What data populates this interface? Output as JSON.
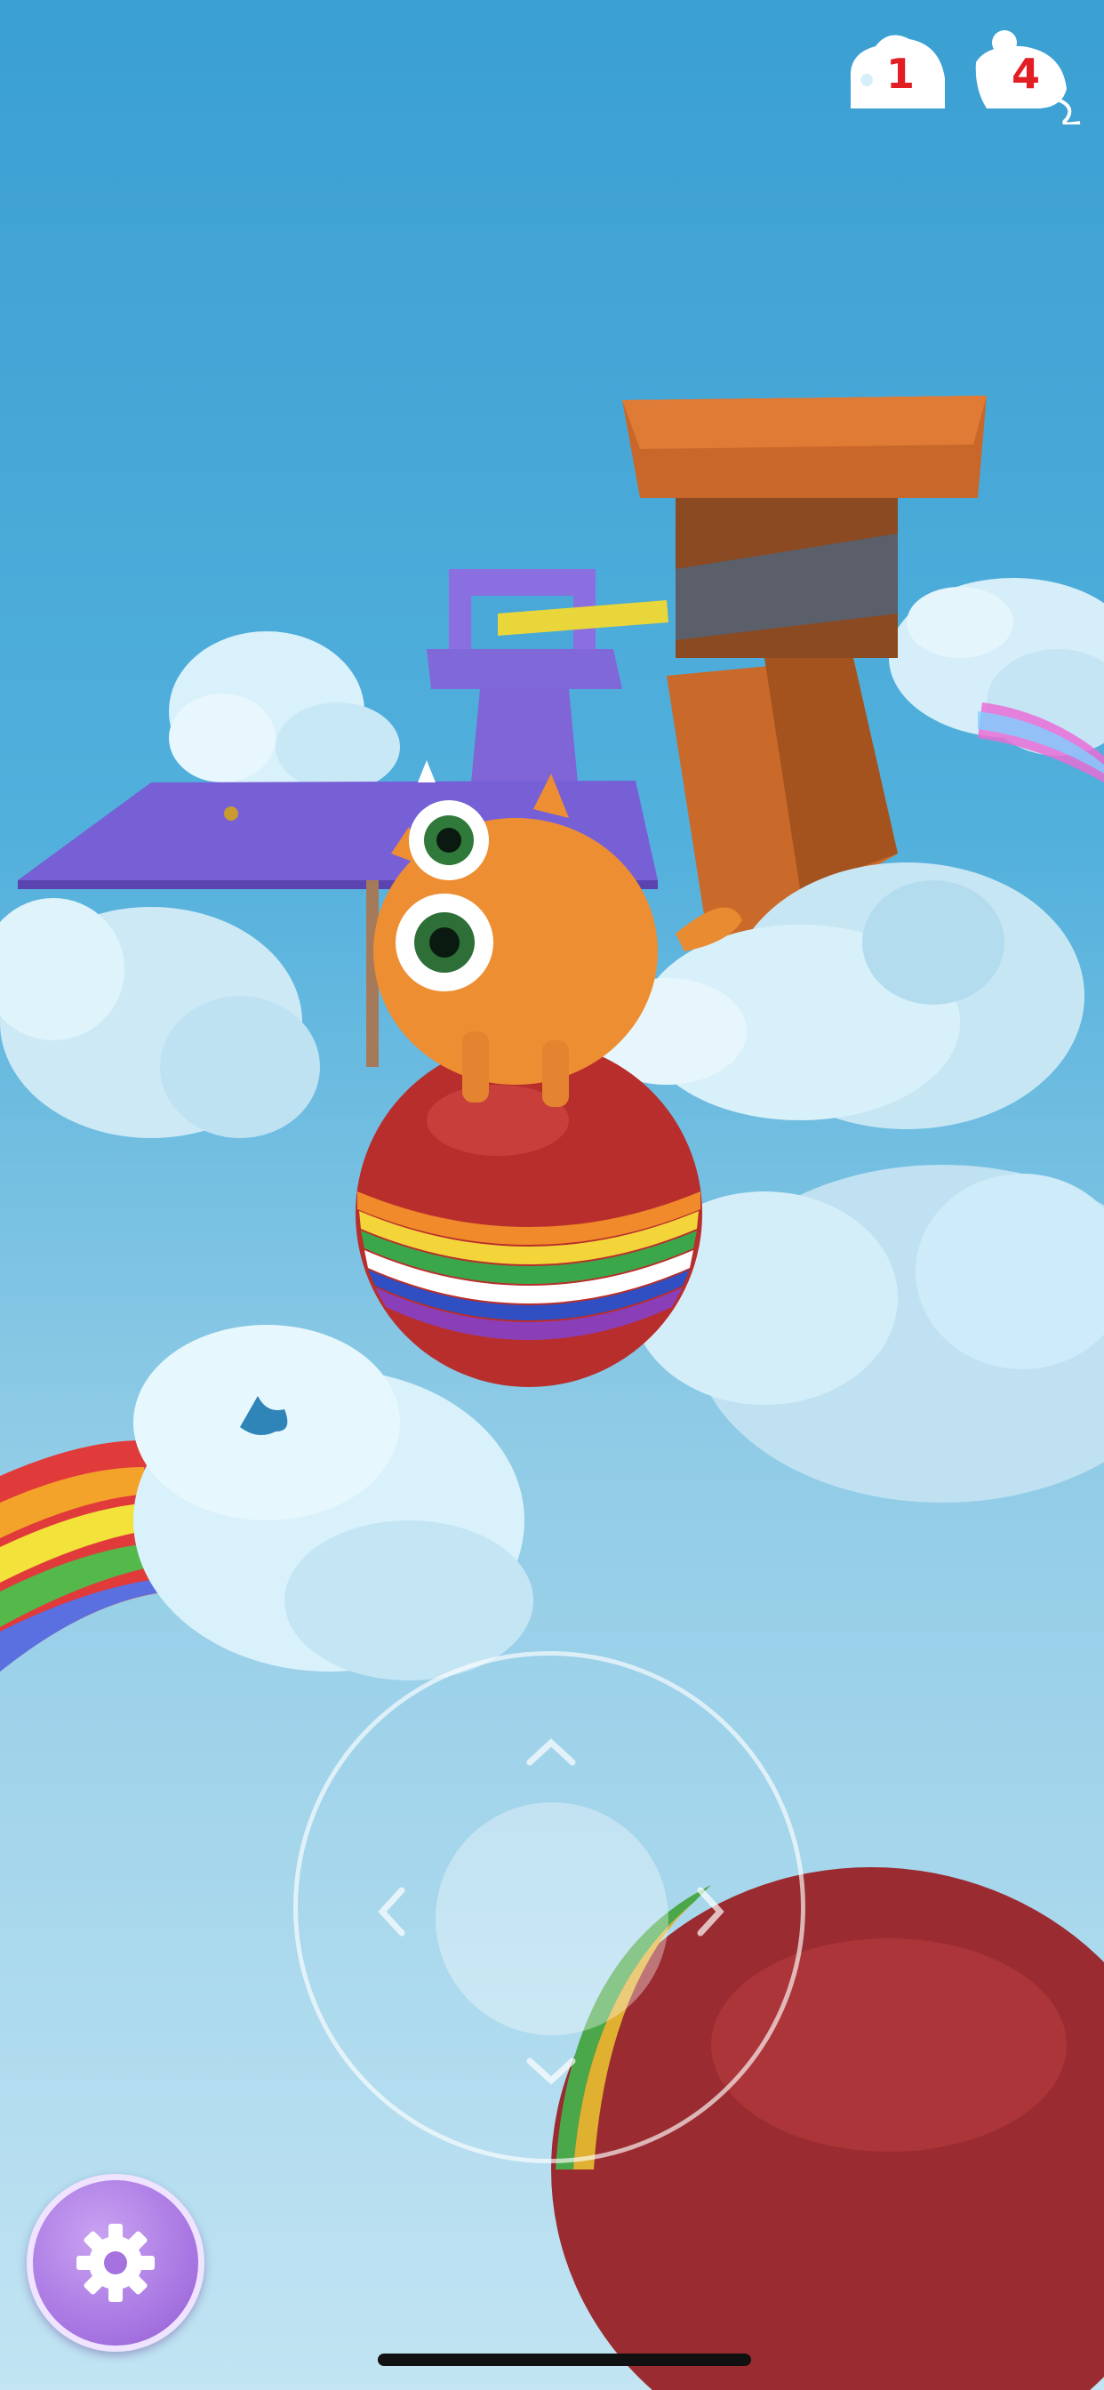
{
  "hud": {
    "cheese_count": "1",
    "mouse_count": "4",
    "cheese_icon": "cheese-icon",
    "mouse_icon": "mouse-icon"
  },
  "controls": {
    "joystick_icons": [
      "chevron-up-icon",
      "chevron-left-icon",
      "chevron-right-icon",
      "chevron-down-icon"
    ],
    "settings_icon": "gear-icon"
  },
  "colors": {
    "counter_text": "#e21e24",
    "settings_button": "#a572e0",
    "sky": "#3a9fd2"
  }
}
